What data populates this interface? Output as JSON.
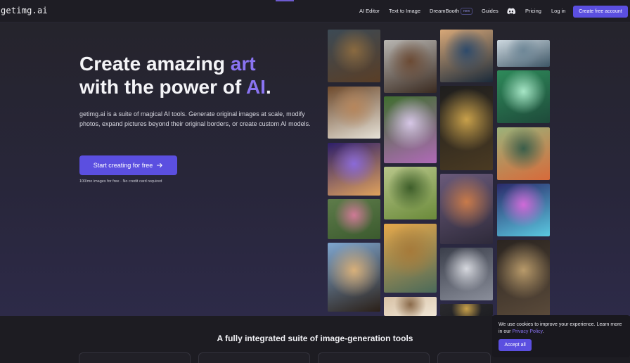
{
  "nav": {
    "logo": "getimg.ai",
    "links": [
      "AI Editor",
      "Text to Image",
      "DreamBooth",
      "Guides",
      "Pricing",
      "Log in"
    ],
    "new_badge": "new",
    "cta": "Create free account"
  },
  "hero": {
    "line1_start": "Create amazing ",
    "line1_accent": "art",
    "line2_start": "with the power of ",
    "line2_accent": "AI",
    "line2_end": ".",
    "description": "getimg.ai is a suite of magical AI tools. Generate original images at scale, modify photos, expand pictures beyond their original borders, or create custom AI models.",
    "button": "Start creating for free",
    "note": "100/mo images for free · No credit card required"
  },
  "gallery": {
    "tiles": [
      {
        "name": "gallery-portrait-man",
        "colors": [
          "#3c4a55",
          "#8a6a40",
          "#5a3e26"
        ]
      },
      {
        "name": "gallery-cabin-bedroom",
        "colors": [
          "#6e4a2c",
          "#b6865c",
          "#e6e2d8"
        ]
      },
      {
        "name": "gallery-cosmic-cat",
        "colors": [
          "#2d1e6a",
          "#8b6ad8",
          "#e0a25c"
        ]
      },
      {
        "name": "gallery-rose-garden",
        "colors": [
          "#5e7c4a",
          "#cf7a96",
          "#3b5a2e"
        ]
      },
      {
        "name": "gallery-horse-rider",
        "colors": [
          "#7fa6cf",
          "#d8b07a",
          "#2b2018"
        ]
      },
      {
        "name": "gallery-curly-hair-man",
        "colors": [
          "#b8b6b2",
          "#6b4a34",
          "#3a2a20"
        ]
      },
      {
        "name": "gallery-flower-goddess",
        "colors": [
          "#3f6e2e",
          "#d6c6e6",
          "#b06ab8"
        ]
      },
      {
        "name": "gallery-big-tree",
        "colors": [
          "#b8c68a",
          "#3e5e2a",
          "#6a8a3a"
        ]
      },
      {
        "name": "gallery-pyramid",
        "colors": [
          "#e6a84a",
          "#a67a3a",
          "#4a6a5a"
        ]
      },
      {
        "name": "gallery-arches",
        "colors": [
          "#d8c2a6",
          "#8a6a4a",
          "#f0e6d6"
        ]
      },
      {
        "name": "gallery-stormy-sea",
        "colors": [
          "#d8a878",
          "#2e4a6a",
          "#1a2a3a"
        ]
      },
      {
        "name": "gallery-golden-skull",
        "colors": [
          "#1e1e1e",
          "#c8a04a",
          "#4a3a22"
        ]
      },
      {
        "name": "gallery-mushroom-forest",
        "colors": [
          "#6a5a7a",
          "#c87a4a",
          "#2e2a3a"
        ]
      },
      {
        "name": "gallery-glowing-sneaker",
        "colors": [
          "#3a3e4a",
          "#d6d8de",
          "#8a8e9a"
        ]
      },
      {
        "name": "gallery-gold-orb",
        "colors": [
          "#2a2a2e",
          "#c8a04a",
          "#1e1e22"
        ]
      },
      {
        "name": "gallery-sea-clouds",
        "colors": [
          "#cdd8df",
          "#6e8797",
          "#3e5666"
        ]
      },
      {
        "name": "gallery-green-hair-girl",
        "colors": [
          "#2e8a5a",
          "#a6e6c6",
          "#1e4a3a"
        ]
      },
      {
        "name": "gallery-koi-pond",
        "colors": [
          "#9ab27a",
          "#3a5e4a",
          "#d86a3a"
        ]
      },
      {
        "name": "gallery-neon-hamster",
        "colors": [
          "#2a2a6a",
          "#d06ad8",
          "#5ac8e0"
        ]
      },
      {
        "name": "gallery-armored-woman",
        "colors": [
          "#2a2420",
          "#b89a6a",
          "#5a4a3a"
        ]
      }
    ]
  },
  "features": {
    "title": "A fully integrated suite of image-generation tools"
  },
  "cookie": {
    "text": "We use cookies to improve your experience. Learn more in our ",
    "link": "Privacy Policy",
    "end": ".",
    "button": "Accept all"
  },
  "colors": {
    "accent": "#5b4fe0",
    "accent_text": "#8a74f2",
    "background": "#22212a"
  }
}
